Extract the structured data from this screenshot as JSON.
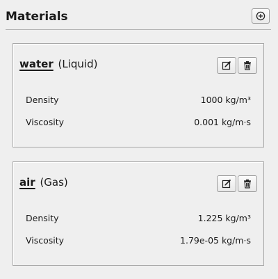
{
  "panel": {
    "title": "Materials",
    "add_icon": "plus-circle-icon"
  },
  "materials": [
    {
      "name": "water",
      "phase": "(Liquid)",
      "edit_icon": "edit-icon",
      "delete_icon": "trash-icon",
      "properties": [
        {
          "label": "Density",
          "value": "1000 kg/m³"
        },
        {
          "label": "Viscosity",
          "value": "0.001 kg/m·s"
        }
      ]
    },
    {
      "name": "air",
      "phase": "(Gas)",
      "edit_icon": "edit-icon",
      "delete_icon": "trash-icon",
      "properties": [
        {
          "label": "Density",
          "value": "1.225 kg/m³"
        },
        {
          "label": "Viscosity",
          "value": "1.79e-05 kg/m·s"
        }
      ]
    }
  ]
}
